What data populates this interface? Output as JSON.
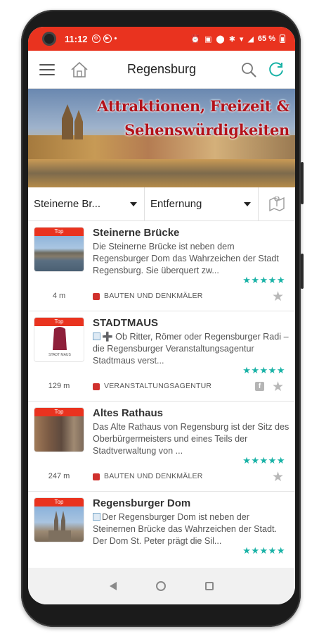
{
  "status": {
    "time": "11:12",
    "battery": "65 %"
  },
  "appbar": {
    "title": "Regensburg"
  },
  "banner": {
    "line1": "Attraktionen, Freizeit &",
    "line2": "Sehenswürdigkeiten"
  },
  "filters": {
    "place": "Steinerne Br...",
    "sort": "Entfernung"
  },
  "items": [
    {
      "badge": "Top",
      "title": "Steinerne Brücke",
      "description": "Die Steinerne Brücke ist neben dem Regensburger Dom das Wahrzeichen der Stadt Regensburg. Sie überquert zw...",
      "rating": "★★★★★",
      "distance": "4 m",
      "category": "BAUTEN UND DENKMÄLER"
    },
    {
      "badge": "Top",
      "title": "STADTMAUS",
      "description": "➕ Ob Ritter, Römer oder Regensburger Radi – die Regensburger Veranstaltungsagentur Stadtmaus verst...",
      "rating": "★★★★★",
      "distance": "129 m",
      "category": "VERANSTALTUNGSAGENTUR",
      "thumb_text": "STADT MAUS"
    },
    {
      "badge": "Top",
      "title": "Altes Rathaus",
      "description": "Das Alte Rathaus von Regensburg ist der Sitz des Oberbürgermeisters und eines Teils der Stadtverwaltung von ...",
      "rating": "★★★★★",
      "distance": "247 m",
      "category": "BAUTEN UND DENKMÄLER"
    },
    {
      "badge": "Top",
      "title": "Regensburger Dom",
      "description": "Der Regensburger Dom ist neben der Steinernen Brücke das Wahrzeichen der Stadt. Der Dom St. Peter prägt die Sil...",
      "rating": "★★★★★"
    }
  ],
  "colors": {
    "accent": "#e9331f",
    "rating": "#19b2a6",
    "category": "#d0312d"
  }
}
